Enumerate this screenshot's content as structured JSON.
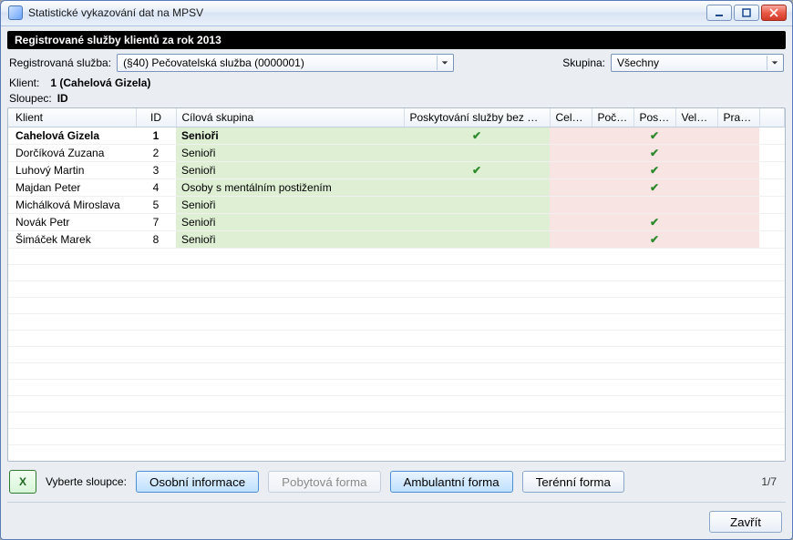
{
  "window": {
    "title": "Statistické vykazování dat na MPSV"
  },
  "subheader": "Registrované služby klientů za rok 2013",
  "filters": {
    "service_label": "Registrovaná služba:",
    "service_value": "(§40) Pečovatelská služba (0000001)",
    "group_label": "Skupina:",
    "group_value": "Všechny"
  },
  "selection": {
    "klient_label": "Klient:",
    "klient_value": "1 (Cahelová Gizela)",
    "sloupec_label": "Sloupec:",
    "sloupec_value": "ID"
  },
  "columns": {
    "klient": "Klient",
    "id": "ID",
    "cilova": "Cílová skupina",
    "bezuhrady": "Poskytování služby bez úhrady",
    "celko": "Celko...",
    "pocet": "Počet...",
    "posky": "Posky...",
    "velke": "Velké...",
    "prani": "Praní ..."
  },
  "rows": [
    {
      "klient": "Cahelová Gizela",
      "id": "1",
      "cilova": "Senioři",
      "bezuhrady": true,
      "posky": true
    },
    {
      "klient": "Dorčíková Zuzana",
      "id": "2",
      "cilova": "Senioři",
      "bezuhrady": false,
      "posky": true
    },
    {
      "klient": "Luhový Martin",
      "id": "3",
      "cilova": "Senioři",
      "bezuhrady": true,
      "posky": true
    },
    {
      "klient": "Majdan Peter",
      "id": "4",
      "cilova": "Osoby s mentálním postižením",
      "bezuhrady": false,
      "posky": true
    },
    {
      "klient": "Michálková Miroslava",
      "id": "5",
      "cilova": "Senioři",
      "bezuhrady": false,
      "posky": false
    },
    {
      "klient": "Novák Petr",
      "id": "7",
      "cilova": "Senioři",
      "bezuhrady": false,
      "posky": true
    },
    {
      "klient": "Šimáček Marek",
      "id": "8",
      "cilova": "Senioři",
      "bezuhrady": false,
      "posky": true
    }
  ],
  "bottom": {
    "vyberte_sloupce": "Vyberte sloupce:",
    "osobni": "Osobní informace",
    "pobytova": "Pobytová forma",
    "ambulantni": "Ambulantní forma",
    "terenni": "Terénní forma",
    "page": "1/7"
  },
  "footer": {
    "close": "Zavřít"
  },
  "icons": {
    "excel": "X"
  }
}
